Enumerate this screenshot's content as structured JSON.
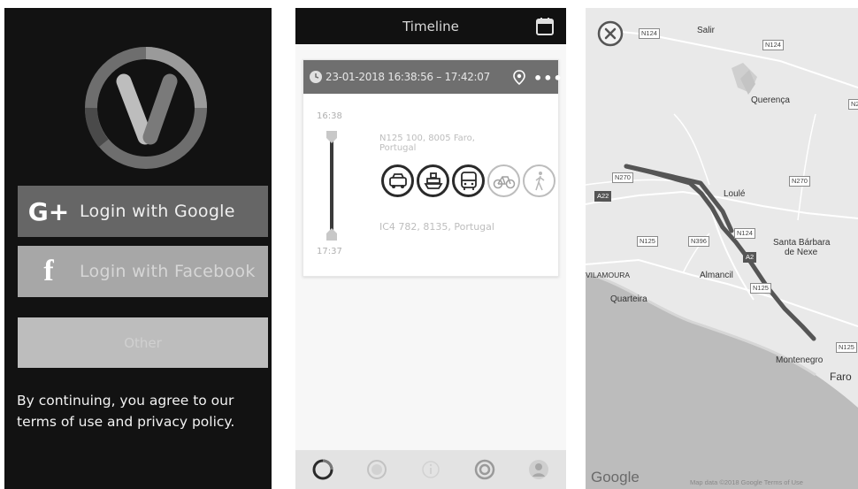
{
  "login": {
    "google_glyph": "G+",
    "google_label": "Login with Google",
    "facebook_glyph": "f",
    "facebook_label": "Login with Facebook",
    "other_label": "Other",
    "terms_line1": "By continuing, you agree to our",
    "terms_line2": "terms of use and privacy policy."
  },
  "timeline": {
    "title": "Timeline",
    "trip": {
      "time_range": "23-01-2018 16:38:56 – 17:42:07",
      "start_time": "16:38",
      "end_time": "17:37",
      "start_address_line1": "N125 100, 8005 Faro,",
      "start_address_line2": "Portugal",
      "end_address": "IC4 782, 8135, Portugal",
      "more_label": "•••"
    },
    "modes": [
      {
        "icon": "car-icon"
      },
      {
        "icon": "boat-icon"
      },
      {
        "icon": "bus-icon"
      },
      {
        "icon": "bicycle-icon"
      },
      {
        "icon": "walk-icon"
      }
    ]
  },
  "map": {
    "places": {
      "salir": "Salir",
      "querenca": "Querença",
      "loule": "Loulé",
      "santa_barbara1": "Santa Bárbara",
      "santa_barbara2": "de Nexe",
      "vilamoura": "VILAMOURA",
      "almancil": "Almancil",
      "quarteira": "Quarteira",
      "montenegro": "Montenegro",
      "faro": "Faro"
    },
    "roads": {
      "n124a": "N124",
      "n124b": "N124",
      "n270a": "N270",
      "n270b": "N270",
      "a22": "A22",
      "n125a": "N125",
      "n396": "N396",
      "n125b": "N125",
      "n125c": "N125",
      "n124c": "N124",
      "a2": "A2"
    },
    "google_logo": "Google",
    "attribution": "Map data ©2018 Google   Terms of Use"
  }
}
